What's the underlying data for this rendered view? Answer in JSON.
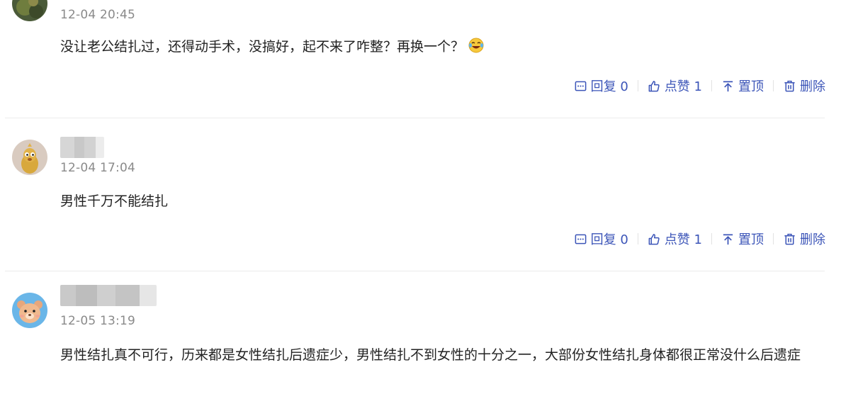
{
  "comments": [
    {
      "time": "12-04 20:45",
      "text": "没让老公结扎过，还得动手术，没搞好，起不来了咋整？再换一个？",
      "emoji_icon": "laughing-tears-emoji",
      "actions": {
        "reply": "回复 0",
        "like": "点赞 1",
        "pin": "置顶",
        "delete": "删除"
      }
    },
    {
      "time": "12-04 17:04",
      "text": "男性千万不能结扎",
      "actions": {
        "reply": "回复 0",
        "like": "点赞 1",
        "pin": "置顶",
        "delete": "删除"
      }
    },
    {
      "time": "12-05 13:19",
      "text": "男性结扎真不可行，历来都是女性结扎后遗症少，男性结扎不到女性的十分之一，大部份女性结扎身体都很正常没什么后遗症"
    }
  ],
  "colors": {
    "action": "#3c55b8",
    "time": "#8a8a8a",
    "divider": "#ececec"
  },
  "icons": [
    "reply-icon",
    "like-icon",
    "pin-icon",
    "delete-icon"
  ]
}
